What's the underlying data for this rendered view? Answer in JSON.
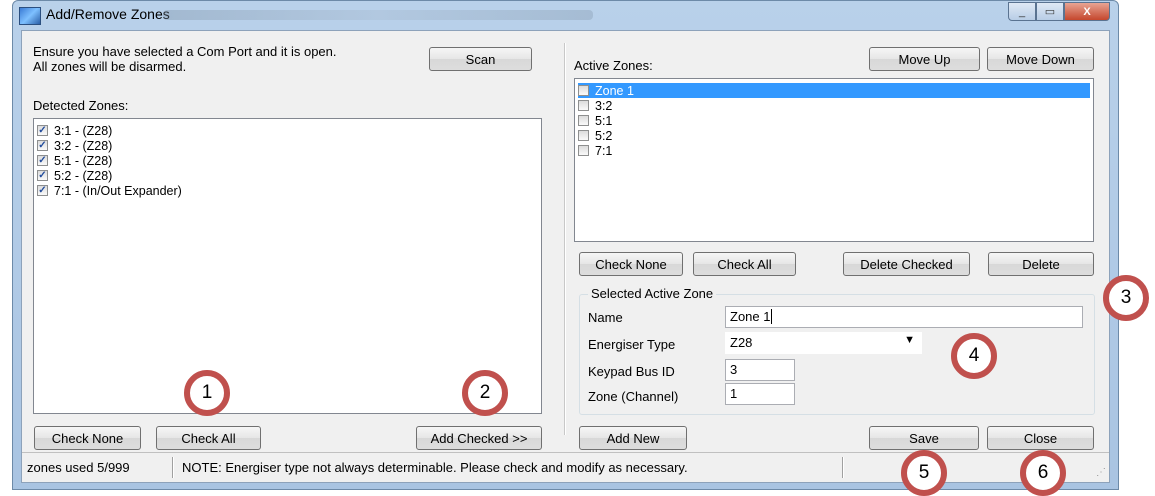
{
  "window": {
    "title": "Add/Remove Zones",
    "close_glyph": "X",
    "minimize_glyph": "_",
    "maximize_glyph": "▭"
  },
  "left": {
    "info_line1": "Ensure you have selected a Com Port and it is open.",
    "info_line2": "All zones will be disarmed.",
    "scan_label": "Scan",
    "detected_label": "Detected Zones:",
    "detected_zones": [
      {
        "label": "3:1 -  (Z28)",
        "checked": true
      },
      {
        "label": "3:2 -  (Z28)",
        "checked": true
      },
      {
        "label": "5:1 -  (Z28)",
        "checked": true
      },
      {
        "label": "5:2 -  (Z28)",
        "checked": true
      },
      {
        "label": "7:1 -  (In/Out Expander)",
        "checked": true
      }
    ],
    "check_none_label": "Check None",
    "check_all_label": "Check All",
    "add_checked_label": "Add Checked >>"
  },
  "right": {
    "active_label": "Active Zones:",
    "move_up_label": "Move Up",
    "move_down_label": "Move Down",
    "active_zones": [
      {
        "label": "Zone 1",
        "checked": false,
        "selected": true
      },
      {
        "label": "3:2",
        "checked": false,
        "selected": false
      },
      {
        "label": "5:1",
        "checked": false,
        "selected": false
      },
      {
        "label": "5:2",
        "checked": false,
        "selected": false
      },
      {
        "label": "7:1",
        "checked": false,
        "selected": false
      }
    ],
    "check_none_label": "Check None",
    "check_all_label": "Check All",
    "delete_checked_label": "Delete Checked",
    "delete_label": "Delete",
    "group_title": "Selected Active Zone",
    "name_label": "Name",
    "name_value": "Zone 1",
    "energiser_label": "Energiser Type",
    "energiser_value": "Z28",
    "keypad_label": "Keypad Bus ID",
    "keypad_value": "3",
    "channel_label": "Zone (Channel)",
    "channel_value": "1",
    "add_new_label": "Add New",
    "save_label": "Save",
    "close_label": "Close"
  },
  "status": {
    "zones_used": "zones used 5/999",
    "note": "NOTE: Energiser type not always determinable. Please check and modify as necessary."
  },
  "markers": [
    "1",
    "2",
    "3",
    "4",
    "5",
    "6"
  ],
  "colors": {
    "marker_ring": "#c0504d",
    "selection": "#3399ff",
    "titlebar": "#b9d1ea"
  }
}
